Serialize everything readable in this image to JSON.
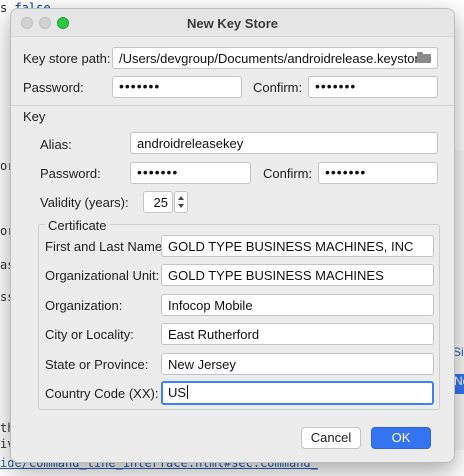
{
  "background": {
    "code_line_1": {
      "text_pre": "s ",
      "keyword": "false"
    },
    "fragments": [
      "ore",
      "ore",
      "as",
      "ss",
      "th",
      "iv"
    ],
    "link": "ide/command_line_interface.html#sec:command_",
    "right_fragments": {
      "link": "Si",
      "button": "Ne",
      "side": "stin"
    }
  },
  "dialog": {
    "title": "New Key Store",
    "keystore_path": {
      "label": "Key store path:",
      "value": "/Users/devgroup/Documents/androidrelease.keystore"
    },
    "password": {
      "label": "Password:",
      "value": "•••••••"
    },
    "confirm": {
      "label": "Confirm:",
      "value": "•••••••"
    },
    "key": {
      "section_label": "Key",
      "alias": {
        "label": "Alias:",
        "value": "androidreleasekey"
      },
      "password": {
        "label": "Password:",
        "value": "•••••••"
      },
      "confirm": {
        "label": "Confirm:",
        "value": "•••••••"
      },
      "validity": {
        "label": "Validity (years):",
        "value": "25"
      }
    },
    "certificate": {
      "label": "Certificate",
      "first_last_name": {
        "label": "First and Last Name:",
        "value": "GOLD TYPE BUSINESS MACHINES, INC"
      },
      "org_unit": {
        "label": "Organizational Unit:",
        "value": "GOLD TYPE BUSINESS MACHINES"
      },
      "organization": {
        "label": "Organization:",
        "value": "Infocop Mobile"
      },
      "city": {
        "label": "City or Locality:",
        "value": "East Rutherford"
      },
      "state": {
        "label": "State or Province:",
        "value": "New Jersey"
      },
      "country": {
        "label": "Country Code (XX):",
        "value": "US"
      }
    },
    "buttons": {
      "cancel": "Cancel",
      "ok": "OK"
    }
  }
}
